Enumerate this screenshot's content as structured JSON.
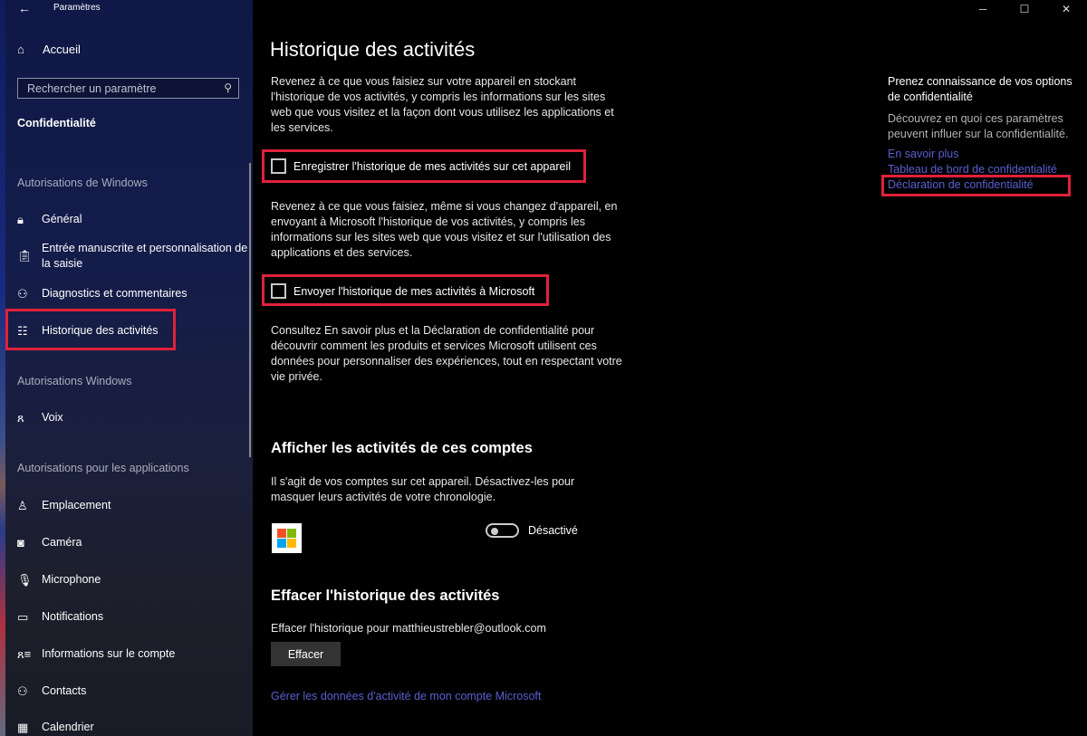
{
  "window": {
    "title": "Paramètres",
    "controls": {
      "minimize": "─",
      "maximize": "☐",
      "close": "✕"
    }
  },
  "sidebar": {
    "home_label": "Accueil",
    "search": {
      "placeholder": "Rechercher un paramètre",
      "value": ""
    },
    "section_title": "Confidentialité",
    "groups": [
      {
        "label": "Autorisations de Windows",
        "items": [
          {
            "label": "Général",
            "icon": "lock-icon"
          },
          {
            "label": "Entrée manuscrite et personnalisation de la saisie",
            "icon": "clipboard-icon"
          },
          {
            "label": "Diagnostics et commentaires",
            "icon": "feedback-icon"
          },
          {
            "label": "Historique des activités",
            "icon": "timeline-icon",
            "selected": true
          }
        ]
      },
      {
        "label": "Autorisations Windows",
        "items": [
          {
            "label": "Voix",
            "icon": "voice-icon"
          }
        ]
      },
      {
        "label": "Autorisations pour les applications",
        "items": [
          {
            "label": "Emplacement",
            "icon": "location-icon"
          },
          {
            "label": "Caméra",
            "icon": "camera-icon"
          },
          {
            "label": "Microphone",
            "icon": "microphone-icon"
          },
          {
            "label": "Notifications",
            "icon": "notification-icon"
          },
          {
            "label": "Informations sur le compte",
            "icon": "account-info-icon"
          },
          {
            "label": "Contacts",
            "icon": "contacts-icon"
          },
          {
            "label": "Calendrier",
            "icon": "calendar-icon"
          }
        ]
      }
    ]
  },
  "main": {
    "title": "Historique des activités",
    "intro": "Revenez à ce que vous faisiez sur votre appareil en stockant l'historique de vos activités, y compris les informations sur les sites web que vous visitez et la façon dont vous utilisez les applications et les services.",
    "checkbox_store": {
      "label": "Enregistrer l'historique de mes activités sur cet appareil",
      "checked": false
    },
    "send_desc": "Revenez à ce que vous faisiez, même si vous changez d'appareil, en envoyant à Microsoft l'historique de vos activités, y compris les informations sur les sites web que vous visitez et sur l'utilisation des applications et des services.",
    "checkbox_send": {
      "label": "Envoyer l'historique de mes activités à Microsoft",
      "checked": false
    },
    "privacy_desc": "Consultez En savoir plus et la Déclaration de confidentialité pour découvrir comment les produits et services Microsoft utilisent ces données pour personnaliser des expériences, tout en respectant votre vie privée.",
    "accounts": {
      "title": "Afficher les activités de ces comptes",
      "desc": "Il s'agit de vos comptes sur cet appareil. Désactivez-les pour masquer leurs activités de votre chronologie.",
      "toggle_state": "Désactivé",
      "toggle_on": false,
      "logo_colors": [
        "#f25022",
        "#7fba00",
        "#00a4ef",
        "#ffb900"
      ]
    },
    "clear": {
      "title": "Effacer l'historique des activités",
      "desc": "Effacer l'historique pour matthieustrebler@outlook.com",
      "button": "Effacer"
    },
    "manage_link": "Gérer les données d'activité de mon compte Microsoft"
  },
  "side_panel": {
    "title": "Prenez connaissance de vos options de confidentialité",
    "desc": "Découvrez en quoi ces paramètres peuvent influer sur la confidentialité.",
    "links": [
      "En savoir plus",
      "Tableau de bord de confidentialité",
      "Déclaration de confidentialité"
    ]
  },
  "colors": {
    "highlight": "#e0213a",
    "link": "#5a5fd0"
  }
}
